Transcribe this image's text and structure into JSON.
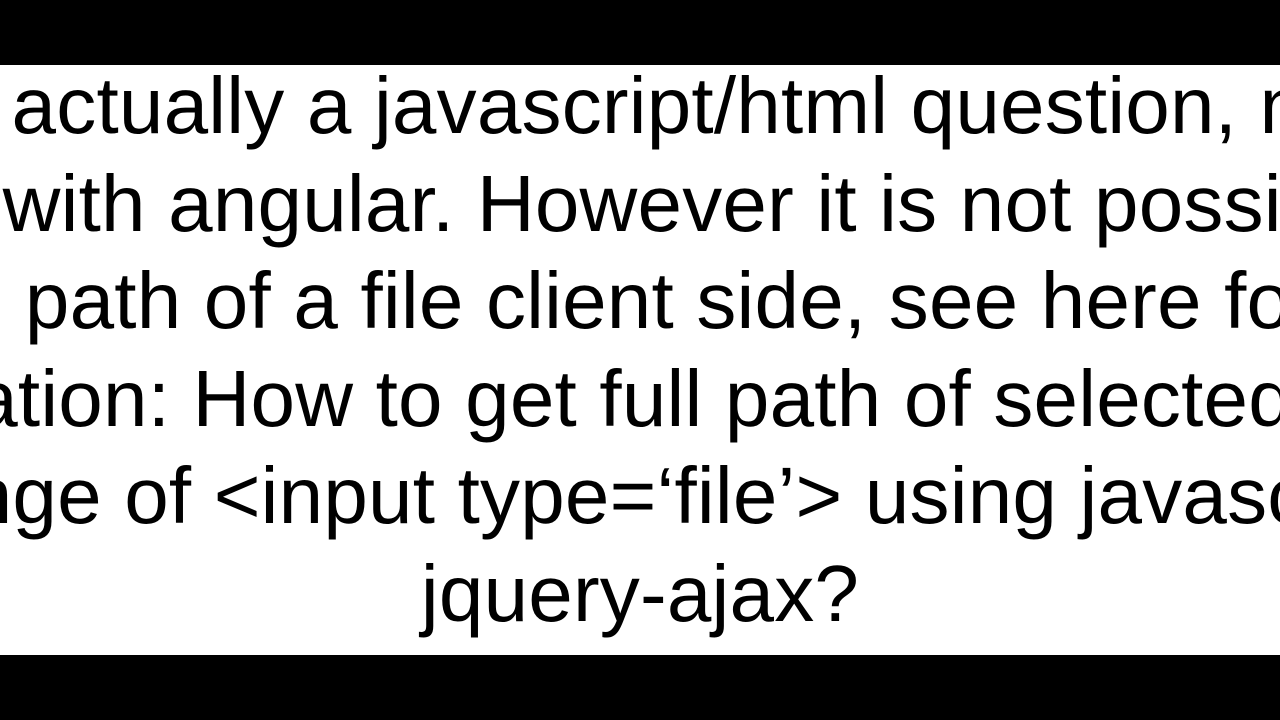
{
  "content": {
    "paragraph": "This is actually a javascript/html question, nothing to do with angular. However it is not possible to get the path of a file client side, see here for more information: How to get full path of selected file on change of <input type=‘file’> using javascript, jquery-ajax?"
  }
}
